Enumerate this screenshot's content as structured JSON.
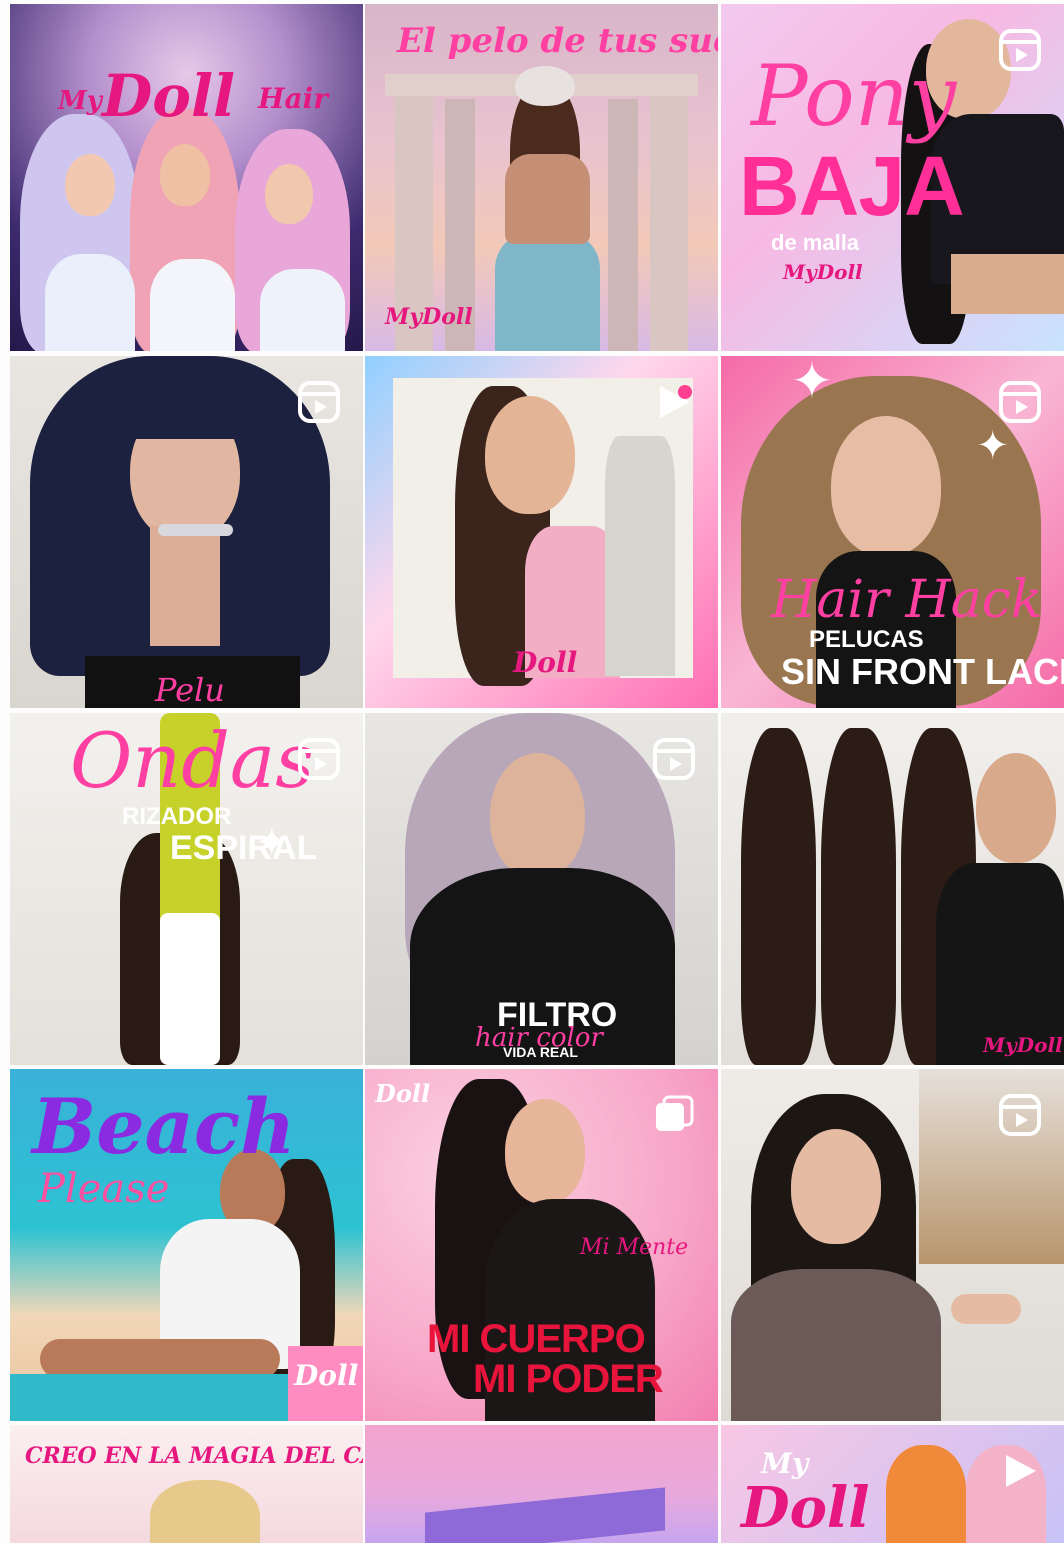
{
  "grid": {
    "posts": [
      {
        "id": "p1",
        "texts": {
          "brand_small": "My",
          "brand": "Doll",
          "brand_tail": "Hair"
        },
        "colors": {
          "bg1": "#3c2a6e",
          "bg2": "#c9a7d6",
          "hair1": "#cfc6f0",
          "hair2": "#f0a3b5",
          "hair3": "#e9a6d8"
        },
        "reel": false
      },
      {
        "id": "p2",
        "texts": {
          "title": "El pelo de tus sueños",
          "brand": "MyDoll"
        },
        "colors": {
          "bg1": "#d7b6c9",
          "bg2": "#f3c9b8"
        },
        "reel": false
      },
      {
        "id": "p3",
        "texts": {
          "script": "Pony",
          "block": "BAJA",
          "sub": "de malla",
          "brand": "MyDoll"
        },
        "colors": {
          "bg1": "#f3c9ef",
          "bg2": "#c8e3ff"
        },
        "reel": true
      },
      {
        "id": "p4",
        "texts": {
          "script": "Pelu"
        },
        "colors": {
          "bg1": "#e9e6e2",
          "bg2": "#d9d5cf",
          "hair": "#1c2140"
        },
        "reel": true
      },
      {
        "id": "p5",
        "texts": {
          "brand": "Doll"
        },
        "colors": {
          "bg1": "#ffd7ec",
          "bg2": "#8fd0ff",
          "hair": "#3a241c"
        },
        "reel": true
      },
      {
        "id": "p6",
        "texts": {
          "script": "Hair Hack",
          "block1": "PELUCAS",
          "block2": "SIN FRONT LACE"
        },
        "colors": {
          "bg1": "#f56aa7",
          "bg2": "#f9b6d4",
          "hair": "#9a7650"
        },
        "reel": true
      },
      {
        "id": "p7",
        "texts": {
          "script": "Ondas",
          "block1": "RIZADOR",
          "block2": "ESPIRAL"
        },
        "colors": {
          "bg1": "#f3f1ee",
          "bg2": "#e4e0da",
          "hair": "#2a1a14"
        },
        "reel": true
      },
      {
        "id": "p8",
        "texts": {
          "block": "FILTRO",
          "script": "hair color",
          "sub": "VIDA REAL"
        },
        "colors": {
          "bg1": "#e8e6e3",
          "bg2": "#d4d2ce",
          "hair": "#b7a7b8"
        },
        "reel": true
      },
      {
        "id": "p9",
        "texts": {
          "brand": "MyDoll"
        },
        "colors": {
          "bg1": "#f1efec",
          "bg2": "#e2dfda",
          "hair": "#2b1c16"
        },
        "reel": false
      },
      {
        "id": "p10",
        "texts": {
          "script": "Beach",
          "script2": "Please",
          "brand": "Doll"
        },
        "colors": {
          "bg1": "#2cc2d2",
          "bg2": "#f1d7b8",
          "hair": "#2a1a14"
        },
        "reel": false
      },
      {
        "id": "p11",
        "texts": {
          "brand": "Doll",
          "script": "Mi Mente",
          "block1": "MI CUERPO",
          "block2": "MI PODER"
        },
        "colors": {
          "bg1": "#fbd1e2",
          "bg2": "#f7a6c7",
          "hair": "#1a1212"
        },
        "reel": false
      },
      {
        "id": "p12",
        "texts": {},
        "colors": {
          "bg1": "#efece8",
          "bg2": "#dedad4",
          "hair": "#1d1714"
        },
        "reel": true
      },
      {
        "id": "p13",
        "texts": {
          "title": "CREO EN LA MAGIA DEL CAMBIO"
        },
        "colors": {
          "bg1": "#fbeff0",
          "bg2": "#f4d9df"
        },
        "reel": false
      },
      {
        "id": "p14",
        "texts": {},
        "colors": {
          "bg1": "#f3a4cd",
          "bg2": "#c6a6f0"
        },
        "reel": false
      },
      {
        "id": "p15",
        "texts": {
          "brand_small": "My",
          "brand": "Doll"
        },
        "colors": {
          "bg1": "#f8c7e4",
          "bg2": "#c7c2f6",
          "hair": "#f08a3a"
        },
        "reel": true
      }
    ]
  }
}
